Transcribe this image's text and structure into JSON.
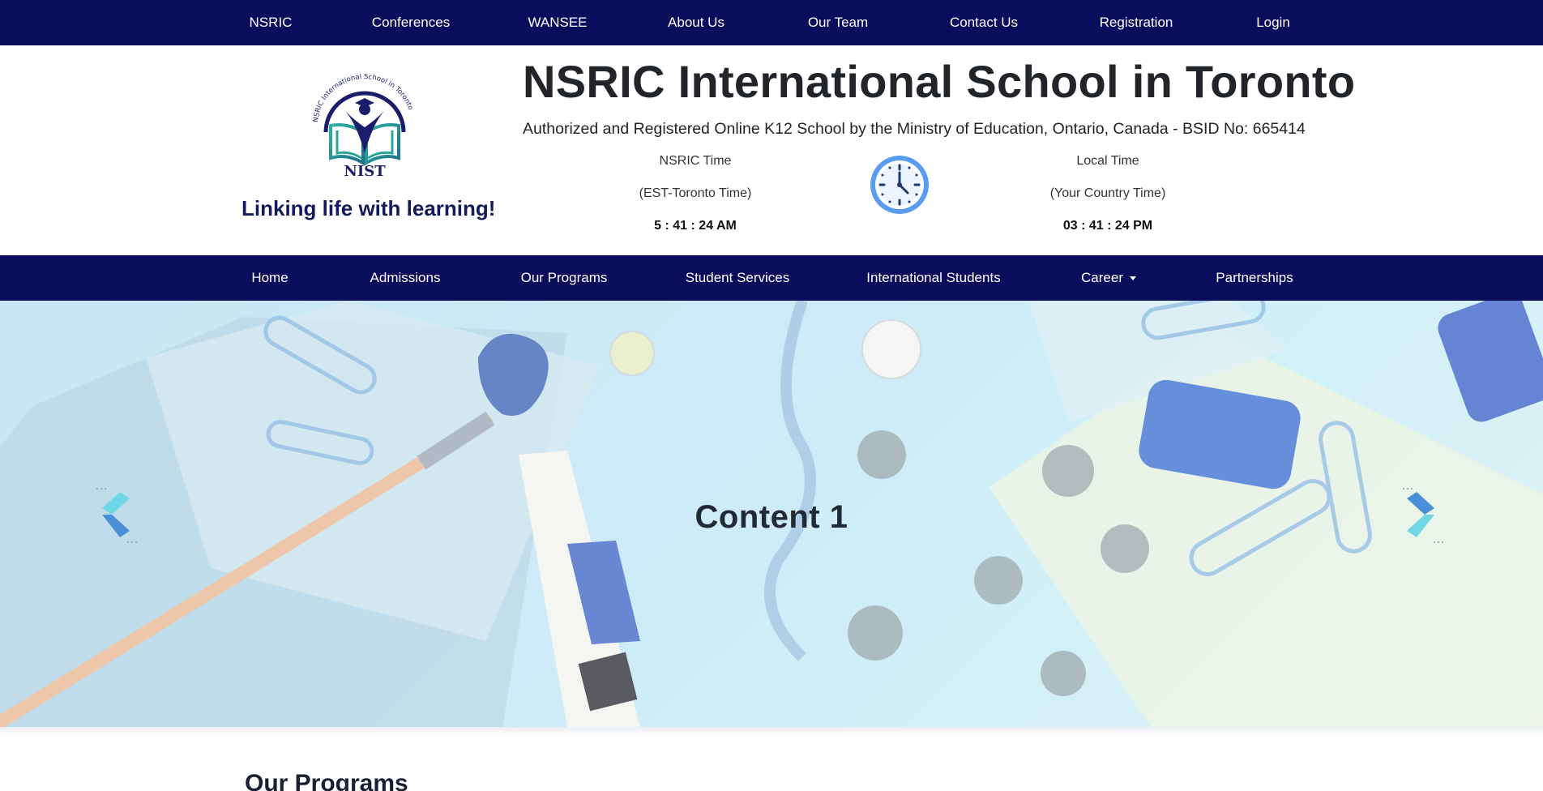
{
  "colors": {
    "nav_bg": "#0a0c5c",
    "nav_text": "#ffffff",
    "tagline": "#141a5e",
    "clock_blue": "#5a9cf0",
    "arrow_cyan": "#6fd6e6",
    "arrow_blue": "#4a90d9"
  },
  "top_nav": {
    "items": [
      {
        "label": "NSRIC"
      },
      {
        "label": "Conferences"
      },
      {
        "label": "WANSEE"
      },
      {
        "label": "About Us"
      },
      {
        "label": "Our Team"
      },
      {
        "label": "Contact Us"
      },
      {
        "label": "Registration"
      },
      {
        "label": "Login"
      }
    ]
  },
  "header": {
    "logo": {
      "arc_text": "NSRIC International School in Toronto",
      "abbr": "NIST"
    },
    "tagline": "Linking life with learning!",
    "title": "NSRIC International School in Toronto",
    "subtitle": "Authorized and Registered Online K12 School by the Ministry of Education, Ontario, Canada - BSID No: 665414",
    "nsric_clock": {
      "label": "NSRIC Time",
      "zone": "(EST-Toronto Time)",
      "time": "5 : 41 : 24 AM"
    },
    "local_clock": {
      "label": "Local Time",
      "zone": "(Your Country Time)",
      "time": "03 : 41 : 24 PM"
    },
    "clock_icon": "clock-icon"
  },
  "main_nav": {
    "items": [
      {
        "label": "Home"
      },
      {
        "label": "Admissions"
      },
      {
        "label": "Our Programs"
      },
      {
        "label": "Student Services"
      },
      {
        "label": "International Students"
      },
      {
        "label": "Career",
        "has_dropdown": true
      },
      {
        "label": "Partnerships"
      }
    ]
  },
  "hero": {
    "slide_title": "Content 1",
    "prev_icon": "chevron-left-icon",
    "next_icon": "chevron-right-icon"
  },
  "programs": {
    "heading": "Our Programs"
  }
}
